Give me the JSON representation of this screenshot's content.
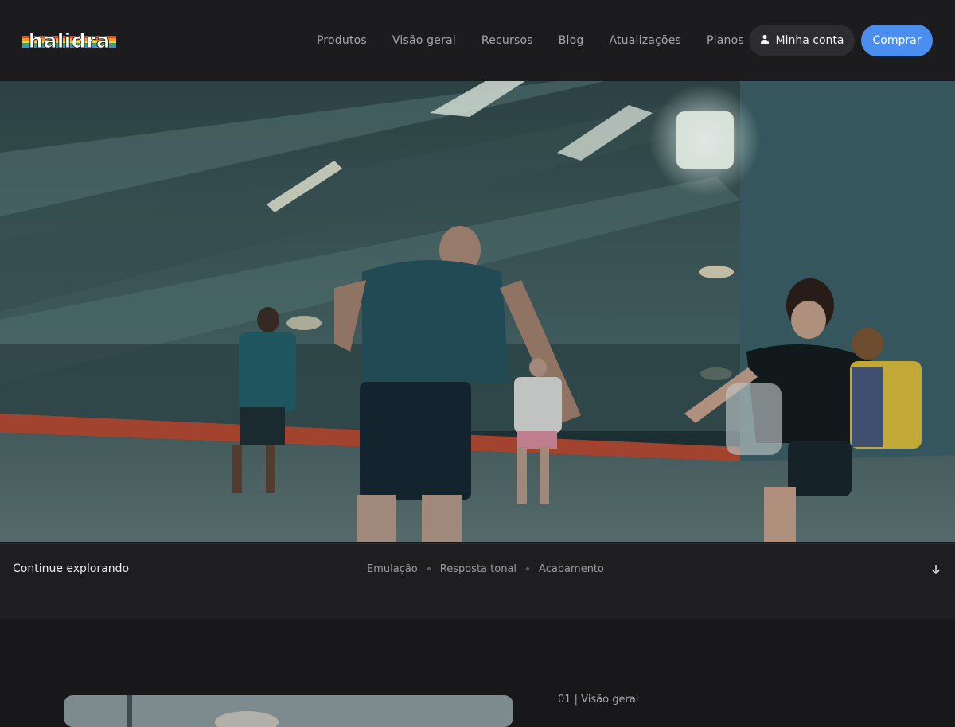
{
  "header": {
    "logo_text": "halidra",
    "nav": [
      "Produtos",
      "Visão geral",
      "Recursos",
      "Blog",
      "Atualizações",
      "Planos"
    ],
    "account_label": "Minha conta",
    "account_icon": "user-icon",
    "buy_label": "Comprar"
  },
  "hero": {
    "image": "indoor-football-scene"
  },
  "explore": {
    "title": "Continue explorando",
    "links": [
      "Emulação",
      "Resposta tonal",
      "Acabamento"
    ],
    "scroll_icon": "arrow-down-icon"
  },
  "section": {
    "label": "01 | Visão geral"
  },
  "colors": {
    "background": "#18181b",
    "header": "#1c1c1f",
    "accent": "#4a8ff0",
    "account_button": "#2c2c31"
  }
}
